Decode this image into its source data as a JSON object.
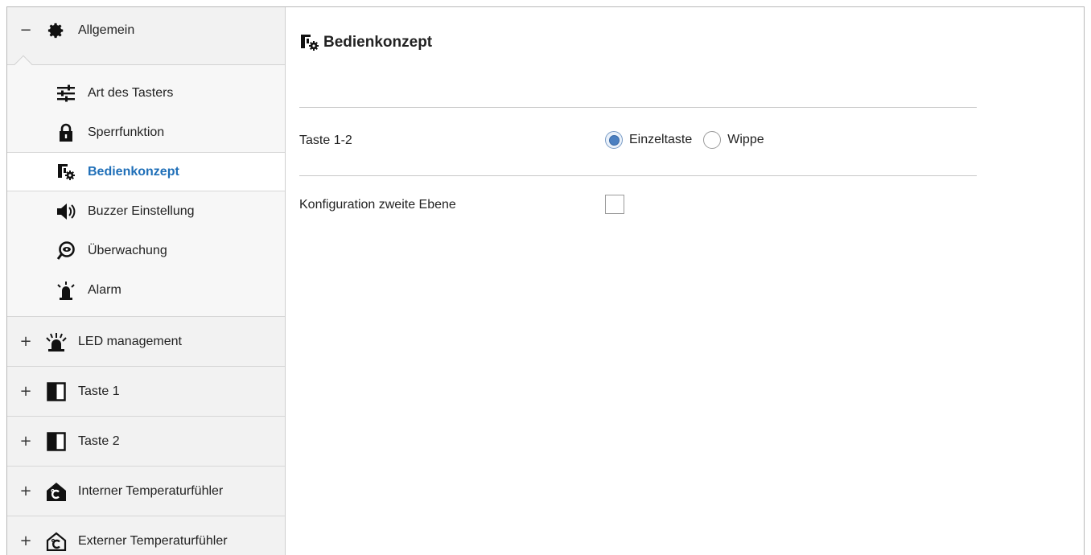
{
  "sidebar": {
    "open_group": {
      "toggle": "−",
      "icon": "gear-icon",
      "label": "Allgemein",
      "items": [
        {
          "icon": "sliders-icon",
          "label": "Art des Tasters"
        },
        {
          "icon": "lock-icon",
          "label": "Sperrfunktion"
        },
        {
          "icon": "button-gear-icon",
          "label": "Bedienkonzept",
          "active": true
        },
        {
          "icon": "speaker-icon",
          "label": "Buzzer Einstellung"
        },
        {
          "icon": "monitor-eye-icon",
          "label": "Überwachung"
        },
        {
          "icon": "alarm-light-icon",
          "label": "Alarm"
        }
      ]
    },
    "groups": [
      {
        "toggle": "+",
        "icon": "led-icon",
        "label": "LED management"
      },
      {
        "toggle": "+",
        "icon": "half-square-icon",
        "label": "Taste 1"
      },
      {
        "toggle": "+",
        "icon": "half-square-icon",
        "label": "Taste 2"
      },
      {
        "toggle": "+",
        "icon": "house-temperature-icon",
        "label": "Interner Temperaturfühler"
      },
      {
        "toggle": "+",
        "icon": "house-temperature-outline-icon",
        "label": "Externer Temperaturfühler"
      }
    ]
  },
  "main": {
    "title": "Bedienkonzept",
    "title_icon": "button-gear-icon",
    "rows": [
      {
        "label": "Taste 1-2",
        "type": "radio",
        "options": [
          "Einzeltaste",
          "Wippe"
        ],
        "selected": "Einzeltaste"
      },
      {
        "label": "Konfiguration zweite Ebene",
        "type": "checkbox",
        "checked": false
      }
    ]
  },
  "colors": {
    "accent": "#1f6fb8",
    "sidebar_bg": "#f2f2f2",
    "radio_checked": "#4a7fc1"
  }
}
